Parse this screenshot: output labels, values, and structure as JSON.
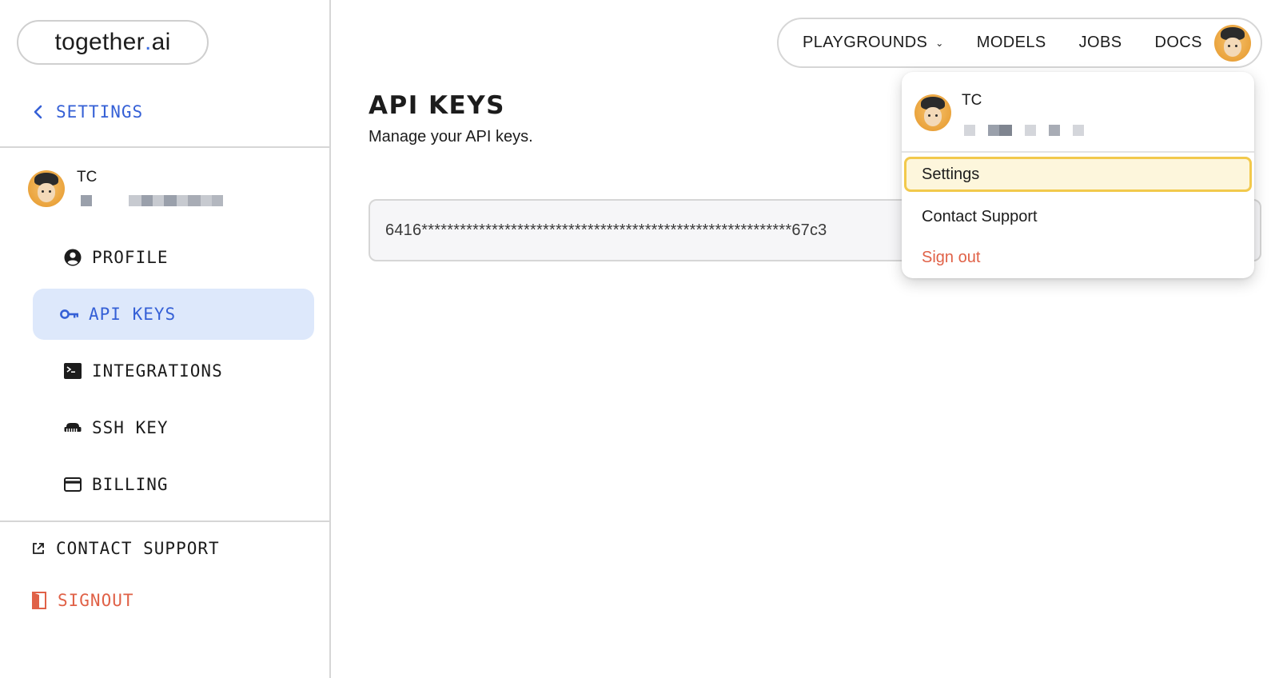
{
  "logo": {
    "text_main": "together",
    "text_dot": ".",
    "text_tail": "ai"
  },
  "sidebar": {
    "back_label": "SETTINGS",
    "user": {
      "name": "TC"
    },
    "items": [
      {
        "label": "PROFILE",
        "icon": "user-circle-icon",
        "active": false
      },
      {
        "label": "API KEYS",
        "icon": "key-icon",
        "active": true
      },
      {
        "label": "INTEGRATIONS",
        "icon": "terminal-icon",
        "active": false
      },
      {
        "label": "SSH KEY",
        "icon": "ssh-key-icon",
        "active": false
      },
      {
        "label": "BILLING",
        "icon": "credit-card-icon",
        "active": false
      }
    ],
    "contact_support": "CONTACT SUPPORT",
    "signout": "SIGNOUT"
  },
  "topnav": {
    "items": [
      {
        "label": "PLAYGROUNDS",
        "has_dropdown": true
      },
      {
        "label": "MODELS"
      },
      {
        "label": "JOBS"
      },
      {
        "label": "DOCS"
      }
    ]
  },
  "main": {
    "title": "API KEYS",
    "subtitle": "Manage your API keys.",
    "api_key": "6416**********************************************************67c3"
  },
  "user_menu": {
    "name": "TC",
    "items": [
      {
        "label": "Settings",
        "selected": true
      },
      {
        "label": "Contact Support"
      },
      {
        "label": "Sign out",
        "danger": true
      }
    ]
  },
  "colors": {
    "accent": "#3560d6",
    "active_bg": "#dde8fb",
    "danger": "#e06147",
    "highlight_border": "#f2c94c",
    "highlight_bg": "#fdf6dc",
    "avatar_bg": "#eaa33c"
  }
}
